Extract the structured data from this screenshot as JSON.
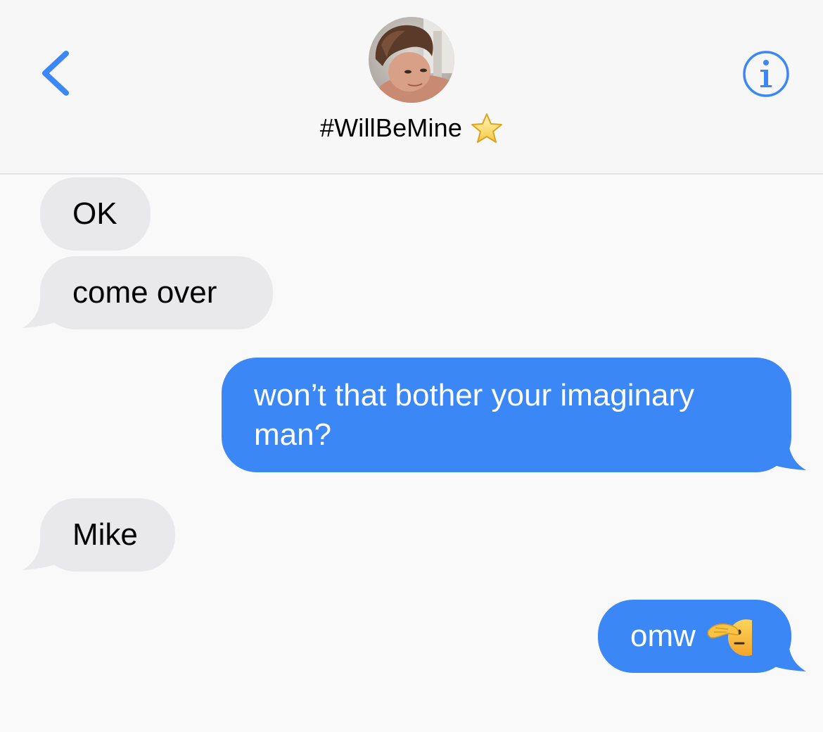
{
  "header": {
    "back_icon": "chevron-left-icon",
    "contact_name": "#WillBeMine",
    "contact_emoji": "star-icon",
    "info_icon": "info-circle-icon",
    "accent_color": "#3a87f5"
  },
  "messages": [
    {
      "direction": "received",
      "text": "OK"
    },
    {
      "direction": "received",
      "text": "come over"
    },
    {
      "direction": "sent",
      "text_line1": "won’t that bother your imaginary",
      "text_line2": "man?"
    },
    {
      "direction": "received",
      "text": "Mike"
    },
    {
      "direction": "sent",
      "text": "omw",
      "emoji": "saluting-face-icon"
    }
  ],
  "colors": {
    "received_bubble": "#e9e9eb",
    "sent_bubble": "#3a87f5",
    "background": "#f9f9f9"
  }
}
